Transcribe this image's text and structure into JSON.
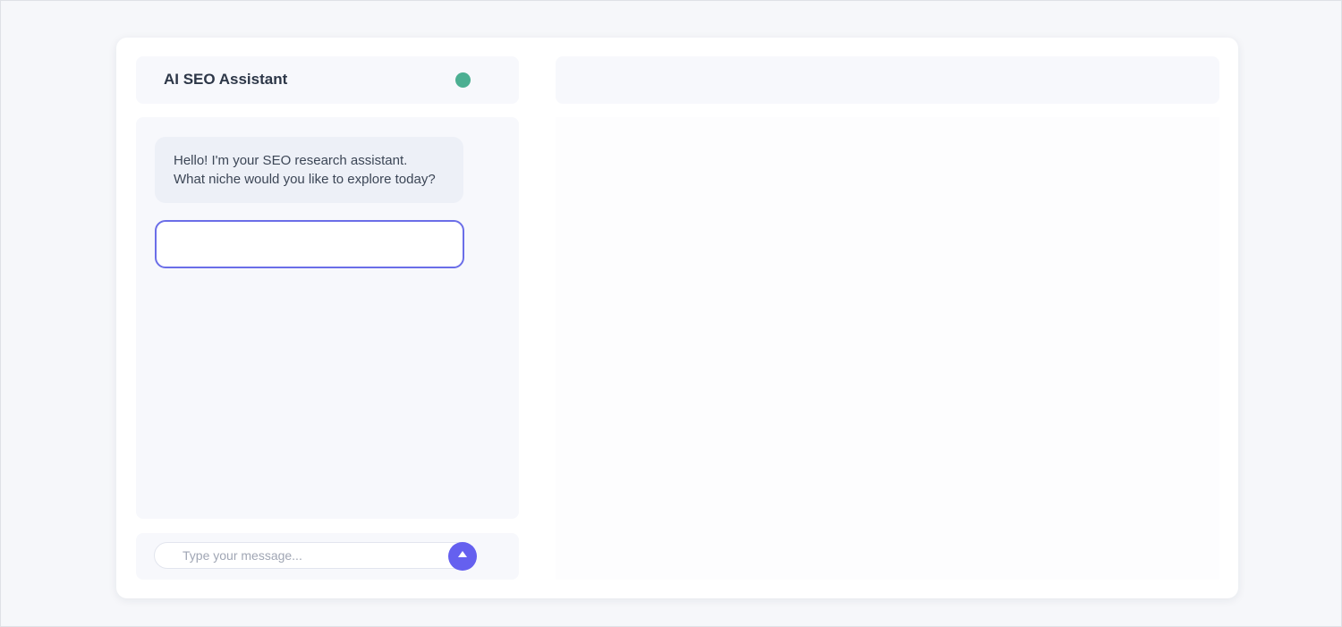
{
  "chat": {
    "title": "AI SEO Assistant",
    "status_color": "#4caf92",
    "messages": [
      {
        "role": "assistant",
        "lines": [
          "Hello! I'm your SEO research assistant.",
          "What niche would you like to explore today?"
        ]
      }
    ],
    "answer_input": {
      "value": ""
    },
    "composer": {
      "placeholder": "Type your message...",
      "value": "",
      "send_icon": "arrow-up-icon"
    }
  },
  "results": {
    "header": ""
  },
  "colors": {
    "accent": "#6560ef",
    "focus_border": "#6b6ee8",
    "bubble_bg": "#edf0f7",
    "panel_bg": "#f7f8fc"
  }
}
